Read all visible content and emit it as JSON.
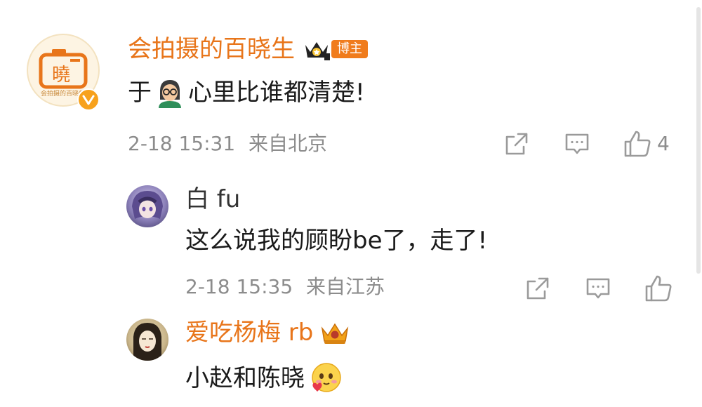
{
  "comments": [
    {
      "username": "会拍摄的百晓生",
      "badge_label": "博主",
      "text_before": "于",
      "text_after": "心里比谁都清楚!",
      "timestamp": "2-18 15:31",
      "location": "来自北京",
      "like_count": "4",
      "avatar_glyph": "曉",
      "avatar_caption": "会拍摄的百晓生"
    },
    {
      "username": "白 fu",
      "text": "这么说我的顾盼be了，走了!",
      "timestamp": "2-18 15:35",
      "location": "来自江苏"
    },
    {
      "username": "爱吃杨梅 rb",
      "text": "小赵和陈晓"
    }
  ],
  "icons": [
    "share-icon",
    "comment-icon",
    "like-icon",
    "crown-icon",
    "verified-icon",
    "teacher-emoji-icon",
    "blush-heart-emoji-icon"
  ],
  "colors": {
    "accent": "#e8751a",
    "meta": "#8c8c8c",
    "icon": "#9a9a9a"
  }
}
